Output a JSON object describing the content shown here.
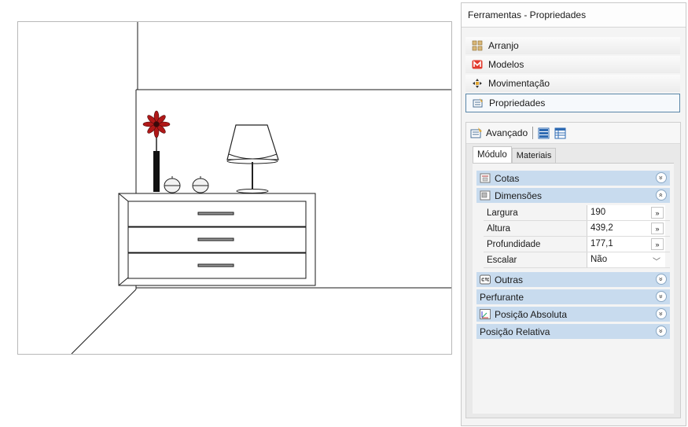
{
  "panel": {
    "title": "Ferramentas - Propriedades"
  },
  "nav": {
    "items": [
      {
        "label": "Arranjo",
        "icon": "grid-icon"
      },
      {
        "label": "Modelos",
        "icon": "models-m-icon"
      },
      {
        "label": "Movimentação",
        "icon": "move-arrows-icon"
      },
      {
        "label": "Propriedades",
        "icon": "properties-icon",
        "active": true
      }
    ]
  },
  "toolbar": {
    "advanced_label": "Avançado"
  },
  "tabs": [
    {
      "label": "Módulo",
      "active": true
    },
    {
      "label": "Materiais",
      "active": false
    }
  ],
  "sections": {
    "cotas": "Cotas",
    "dimensoes": "Dimensões",
    "outras": "Outras",
    "perfurante": "Perfurante",
    "posicao_absoluta": "Posição Absoluta",
    "posicao_relativa": "Posição Relativa"
  },
  "dimensions": [
    {
      "label": "Largura",
      "value": "190",
      "button": "»"
    },
    {
      "label": "Altura",
      "value": "439,2",
      "button": "»"
    },
    {
      "label": "Profundidade",
      "value": "177,1",
      "button": "»"
    },
    {
      "label": "Escalar",
      "value": "Não",
      "dropdown": "﹀"
    }
  ],
  "icons": {
    "expand": "»",
    "collapse": "«"
  },
  "colors": {
    "section_bg": "#c8dbee",
    "active_border": "#5b87a8",
    "flower": "#b01818"
  }
}
